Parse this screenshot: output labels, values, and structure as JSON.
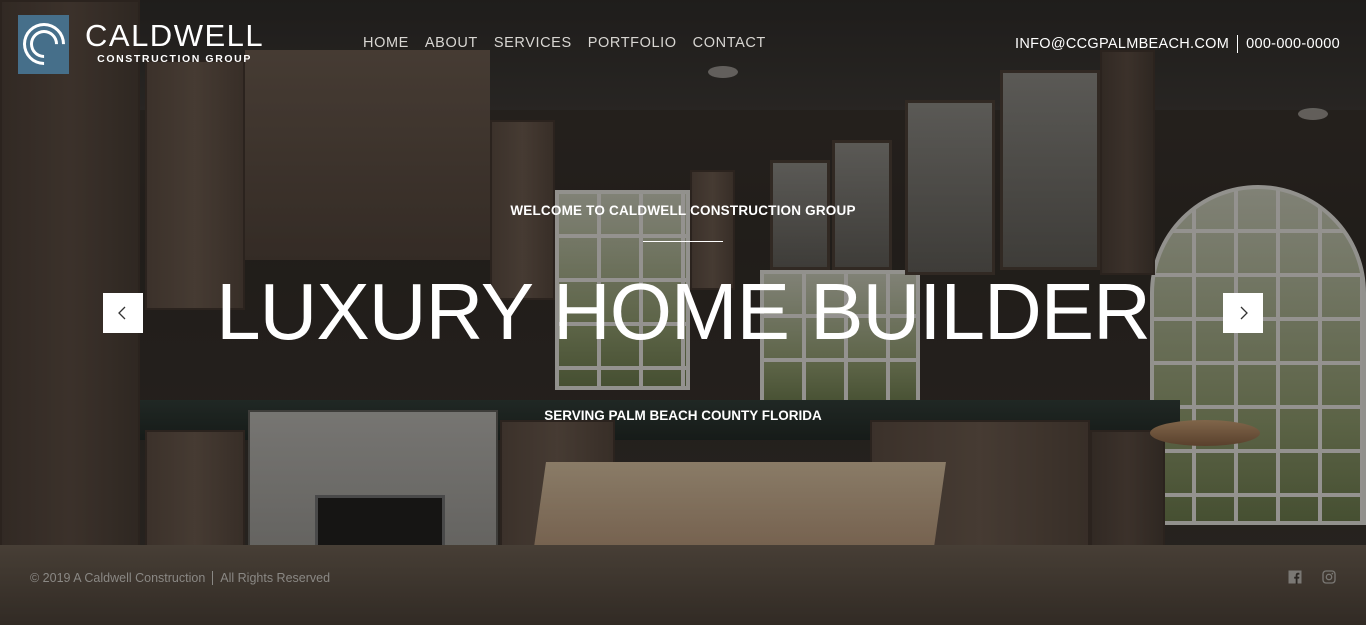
{
  "brand": {
    "name": "CALDWELL",
    "tagline": "CONSTRUCTION GROUP",
    "logo_color": "#466f8a"
  },
  "nav": {
    "items": [
      {
        "label": "HOME"
      },
      {
        "label": "ABOUT"
      },
      {
        "label": "SERVICES"
      },
      {
        "label": "PORTFOLIO"
      },
      {
        "label": "CONTACT"
      }
    ]
  },
  "contact": {
    "email": "INFO@CCGPALMBEACH.COM",
    "phone": "000-000-0000"
  },
  "hero": {
    "kicker": "WELCOME TO CALDWELL CONSTRUCTION GROUP",
    "title": "LUXURY HOME BUILDER",
    "subtitle": "SERVING PALM BEACH COUNTY FLORIDA",
    "prev_icon": "chevron-left-icon",
    "next_icon": "chevron-right-icon"
  },
  "footer": {
    "copyright": "© 2019 A Caldwell Construction",
    "rights": "All Rights Reserved",
    "social": [
      {
        "icon": "facebook-icon"
      },
      {
        "icon": "instagram-icon"
      }
    ]
  }
}
